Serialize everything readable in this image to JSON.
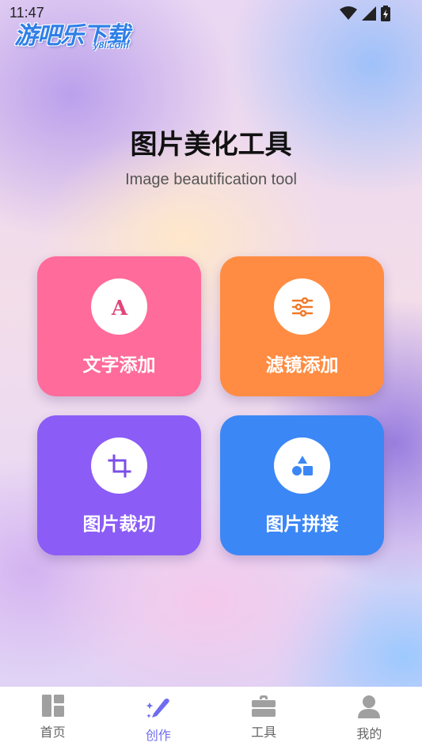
{
  "status_bar": {
    "time": "11:47"
  },
  "watermark": {
    "logo_text": "游吧乐下载",
    "logo_sub": "y8l.com"
  },
  "header": {
    "title": "图片美化工具",
    "subtitle": "Image beautification tool"
  },
  "tools": [
    {
      "label": "文字添加",
      "icon": "letter-a-icon",
      "color": "#ff6b9b"
    },
    {
      "label": "滤镜添加",
      "icon": "sliders-icon",
      "color": "#ff8c42"
    },
    {
      "label": "图片裁切",
      "icon": "crop-icon",
      "color": "#8b5cf6"
    },
    {
      "label": "图片拼接",
      "icon": "shapes-icon",
      "color": "#3b87f6"
    }
  ],
  "bottom_nav": {
    "active": "创作",
    "items": [
      {
        "label": "首页",
        "icon": "dashboard-icon"
      },
      {
        "label": "创作",
        "icon": "pen-sparkle-icon"
      },
      {
        "label": "工具",
        "icon": "briefcase-icon"
      },
      {
        "label": "我的",
        "icon": "user-icon"
      }
    ]
  },
  "colors": {
    "accent": "#6f6cf0",
    "nav_inactive": "#a0a0a0"
  }
}
